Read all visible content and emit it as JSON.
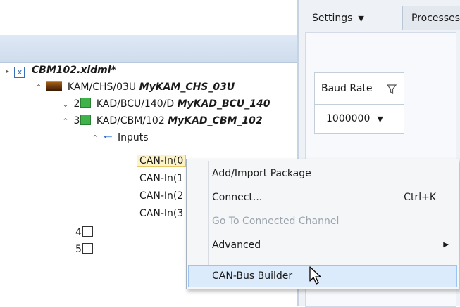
{
  "tree": {
    "root": {
      "label": "CBM102.xidml*"
    },
    "chassis": {
      "label": "KAM/CHS/03U",
      "name": "MyKAM_CHS_03U"
    },
    "slot2": {
      "num": "2",
      "label": "KAD/BCU/140/D",
      "name": "MyKAD_BCU_140"
    },
    "slot3": {
      "num": "3",
      "label": "KAD/CBM/102",
      "name": "MyKAD_CBM_102"
    },
    "inputs": {
      "label": "Inputs"
    },
    "channels": [
      "CAN-In(0",
      "CAN-In(1",
      "CAN-In(2",
      "CAN-In(3"
    ],
    "slot4": {
      "num": "4"
    },
    "slot5": {
      "num": "5"
    }
  },
  "tabs": {
    "settings": "Settings",
    "processes": "Processes"
  },
  "settings": {
    "baud_rate_label": "Baud Rate",
    "baud_rate_value": "1000000"
  },
  "context_menu": {
    "items": [
      {
        "label": "Add/Import Package",
        "shortcut": ""
      },
      {
        "label": "Connect...",
        "shortcut": "Ctrl+K"
      },
      {
        "label": "Go To Connected Channel",
        "shortcut": "",
        "disabled": true
      },
      {
        "label": "Advanced",
        "shortcut": "",
        "submenu": true
      },
      {
        "label": "CAN-Bus Builder",
        "shortcut": "",
        "highlighted": true
      }
    ]
  },
  "icons": {
    "file": "xidml-file-icon",
    "chassis": "chassis-icon",
    "module": "module-green-icon",
    "empty_slot": "empty-slot-icon",
    "inputs": "input-arrow-icon",
    "filter": "filter-icon",
    "cursor": "mouse-pointer-icon"
  },
  "colors": {
    "module_green": "#3fb34a",
    "menu_highlight": "#dcebfb",
    "header_blue": "#dfe9f6"
  }
}
